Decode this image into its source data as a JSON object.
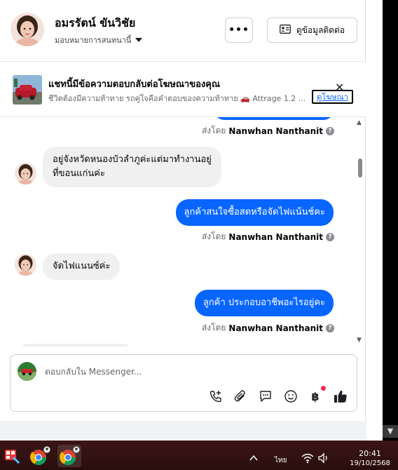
{
  "header": {
    "contact_name": "อมรรัตน์ ขันวิชัย",
    "assign_label": "มอบหมายการสนทนานี้",
    "more_label": "•••",
    "contact_info_label": "ดูข้อมูลติดต่อ"
  },
  "ad_banner": {
    "title": "แชทนี้มีข้อความตอบกลับต่อโฆษณาของคุณ",
    "subtitle": "ชีวิตต้องมีความท้าทาย รถคู่ใจคือคำตอบของความท้าทาย 🚗 Attrage 1.2 ...",
    "view_ad_label": "ดูโฆษณา",
    "close_icon": "close-icon"
  },
  "messages": [
    {
      "type": "sent_by",
      "prefix": "ส่งโดย",
      "name": "Nanwhan Nanthanit"
    },
    {
      "type": "incoming",
      "line1": "อยู่จังหวัดหนองบัวลำภูค่ะแต่มาทำงานอยู่",
      "line2": "ที่ขอนแก่นค่ะ"
    },
    {
      "type": "outgoing",
      "text": "ลูกค้าสนใจซื้อสดหรือจัดไฟแน้นช์คะ"
    },
    {
      "type": "sent_by",
      "prefix": "ส่งโดย",
      "name": "Nanwhan Nanthanit"
    },
    {
      "type": "incoming",
      "text": "จัดไฟแนนซ์ค่ะ"
    },
    {
      "type": "outgoing",
      "text": "ลูกค้า ประกอบอาชีพอะไรอยู่คะ"
    },
    {
      "type": "sent_by",
      "prefix": "ส่งโดย",
      "name": "Nanwhan Nanthanit"
    }
  ],
  "composer": {
    "placeholder": "ตอบกลับใน Messenger...",
    "tools": [
      "phone-add-icon",
      "attach-icon",
      "saved-reply-icon",
      "emoji-icon",
      "baht-icon",
      "thumbs-up-icon"
    ]
  },
  "taskbar": {
    "language": "ไทย",
    "time": "20:41",
    "date": "19/10/2568"
  },
  "colors": {
    "accent": "#0866ff",
    "bubble_in": "#f0f0f0",
    "taskbar": "#2a0e0e"
  }
}
